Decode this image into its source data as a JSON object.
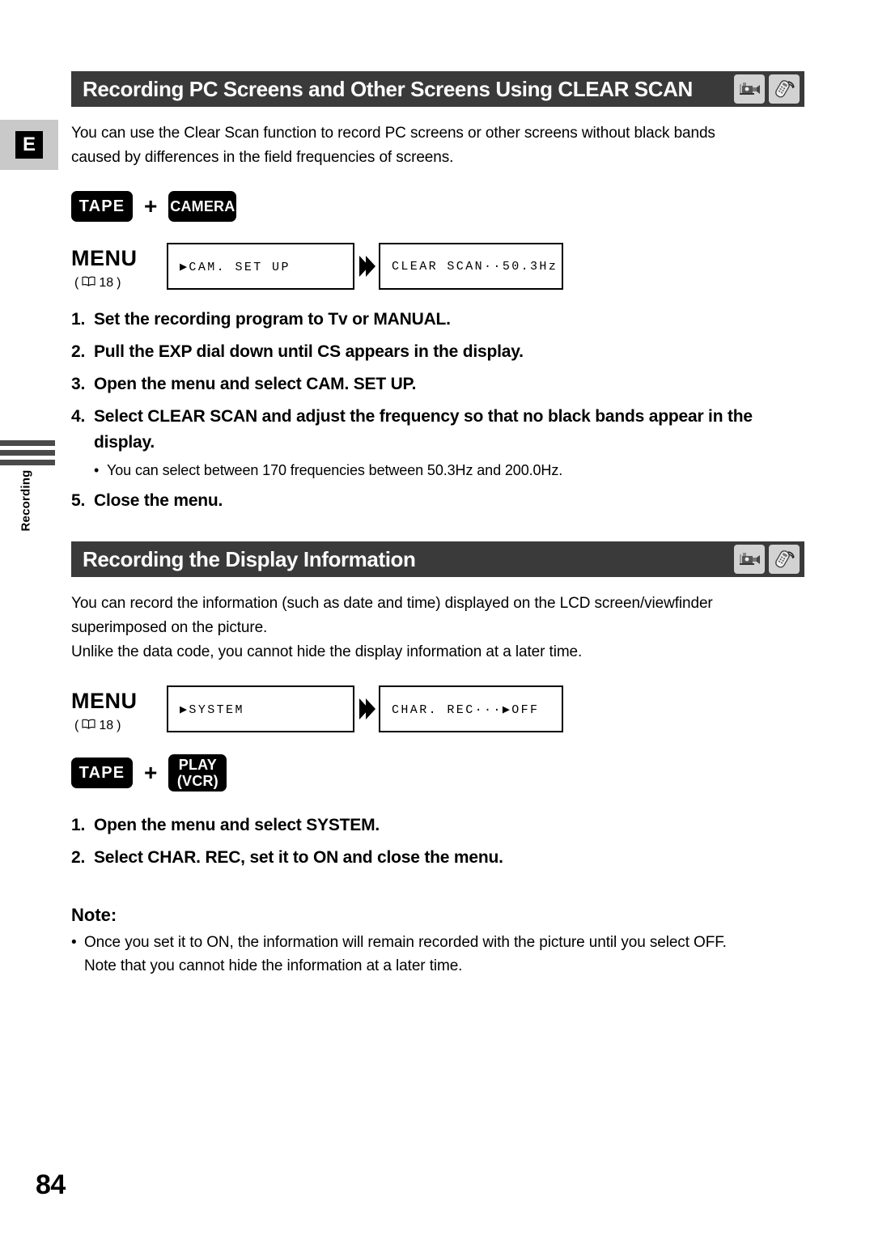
{
  "page": {
    "number": "84",
    "language_tab": "E",
    "side_label": "Recording"
  },
  "sections": [
    {
      "header": {
        "title": "Recording PC Screens and Other Screens Using CLEAR SCAN",
        "icons": [
          "camcorder-icon",
          "remote-control-icon"
        ]
      },
      "intro": [
        "You can use the Clear Scan function to record PC screens or other screens without black bands",
        "caused by differences in the field frequencies of screens."
      ],
      "modes": {
        "first": "TAPE",
        "operator": "+",
        "second": "CAMERA"
      },
      "menu": {
        "label": "MENU",
        "ref_open": "(",
        "ref_icon": "book-icon",
        "ref_page": "18",
        "ref_close": ")",
        "box1": "▶CAM. SET UP",
        "arrow": "double-chevron-right-icon",
        "box2": "CLEAR SCAN··50.3Hz"
      },
      "steps": [
        {
          "num": "1.",
          "text": "Set the recording program to Tv or MANUAL."
        },
        {
          "num": "2.",
          "text": "Pull the EXP dial down until CS appears in the display."
        },
        {
          "num": "3.",
          "text": "Open the menu and select CAM. SET UP."
        },
        {
          "num": "4.",
          "text": "Select CLEAR SCAN and adjust the frequency so that no black bands appear in the display.",
          "bullet": "You can select between 170 frequencies between 50.3Hz and 200.0Hz."
        },
        {
          "num": "5.",
          "text": "Close the menu."
        }
      ]
    },
    {
      "header": {
        "title": "Recording the Display Information",
        "icons": [
          "camcorder-icon",
          "remote-control-icon"
        ]
      },
      "intro": [
        "You can record the information (such as date and time) displayed on the LCD screen/viewfinder",
        "superimposed on the picture.",
        "Unlike the data code, you cannot hide the display information at a later time."
      ],
      "menu": {
        "label": "MENU",
        "ref_open": "(",
        "ref_icon": "book-icon",
        "ref_page": "18",
        "ref_close": ")",
        "box1": "▶SYSTEM",
        "arrow": "double-chevron-right-icon",
        "box2": "CHAR. REC···▶OFF"
      },
      "modes": {
        "first": "TAPE",
        "operator": "+",
        "second_line1": "PLAY",
        "second_line2": "(VCR)"
      },
      "steps": [
        {
          "num": "1.",
          "text": "Open the menu and select SYSTEM."
        },
        {
          "num": "2.",
          "text": "Select CHAR. REC, set it to ON and close the menu."
        }
      ],
      "note": {
        "title": "Note:",
        "items": [
          [
            "Once you set it to ON, the information will remain recorded with the picture until you select OFF.",
            "Note that you cannot hide the information at a later time."
          ]
        ]
      }
    }
  ]
}
